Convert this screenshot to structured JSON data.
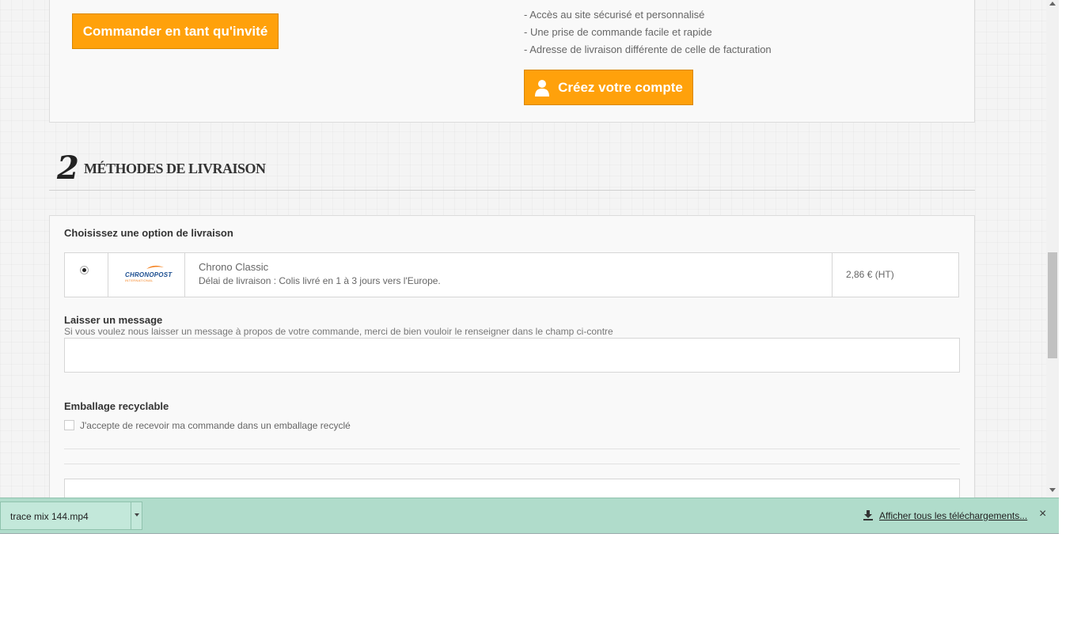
{
  "account": {
    "guest_button": "Commander en tant qu'invité",
    "benefits": [
      "- Accès au site sécurisé et personnalisé",
      "- Une prise de commande facile et rapide",
      "- Adresse de livraison différente de celle de facturation"
    ],
    "create_button": "Créez votre compte"
  },
  "delivery": {
    "step_number": "2",
    "title": "MÉTHODES DE LIVRAISON",
    "choose_label": "Choisissez une option de livraison",
    "option": {
      "logo_text": "CHRONOPOST",
      "logo_sub": "INTERNATIONAL",
      "name": "Chrono Classic",
      "description": "Délai de livraison : Colis livré en 1 à 3 jours vers l'Europe.",
      "price": "2,86 € (HT)",
      "selected": true
    },
    "message": {
      "title": "Laisser un message",
      "hint": "Si vous voulez nous laisser un message à propos de votre commande, merci de bien vouloir le renseigner dans le champ ci-contre",
      "value": ""
    },
    "packaging": {
      "title": "Emballage recyclable",
      "checkbox_label": "J'accepte de recevoir ma commande dans un emballage recyclé",
      "checked": false
    }
  },
  "downloads": {
    "file_name": "trace mix 144.mp4",
    "show_all": "Afficher tous les téléchargements...",
    "close": "×"
  },
  "colors": {
    "accent": "#ffa10b",
    "download_bar": "#b0dccb"
  }
}
